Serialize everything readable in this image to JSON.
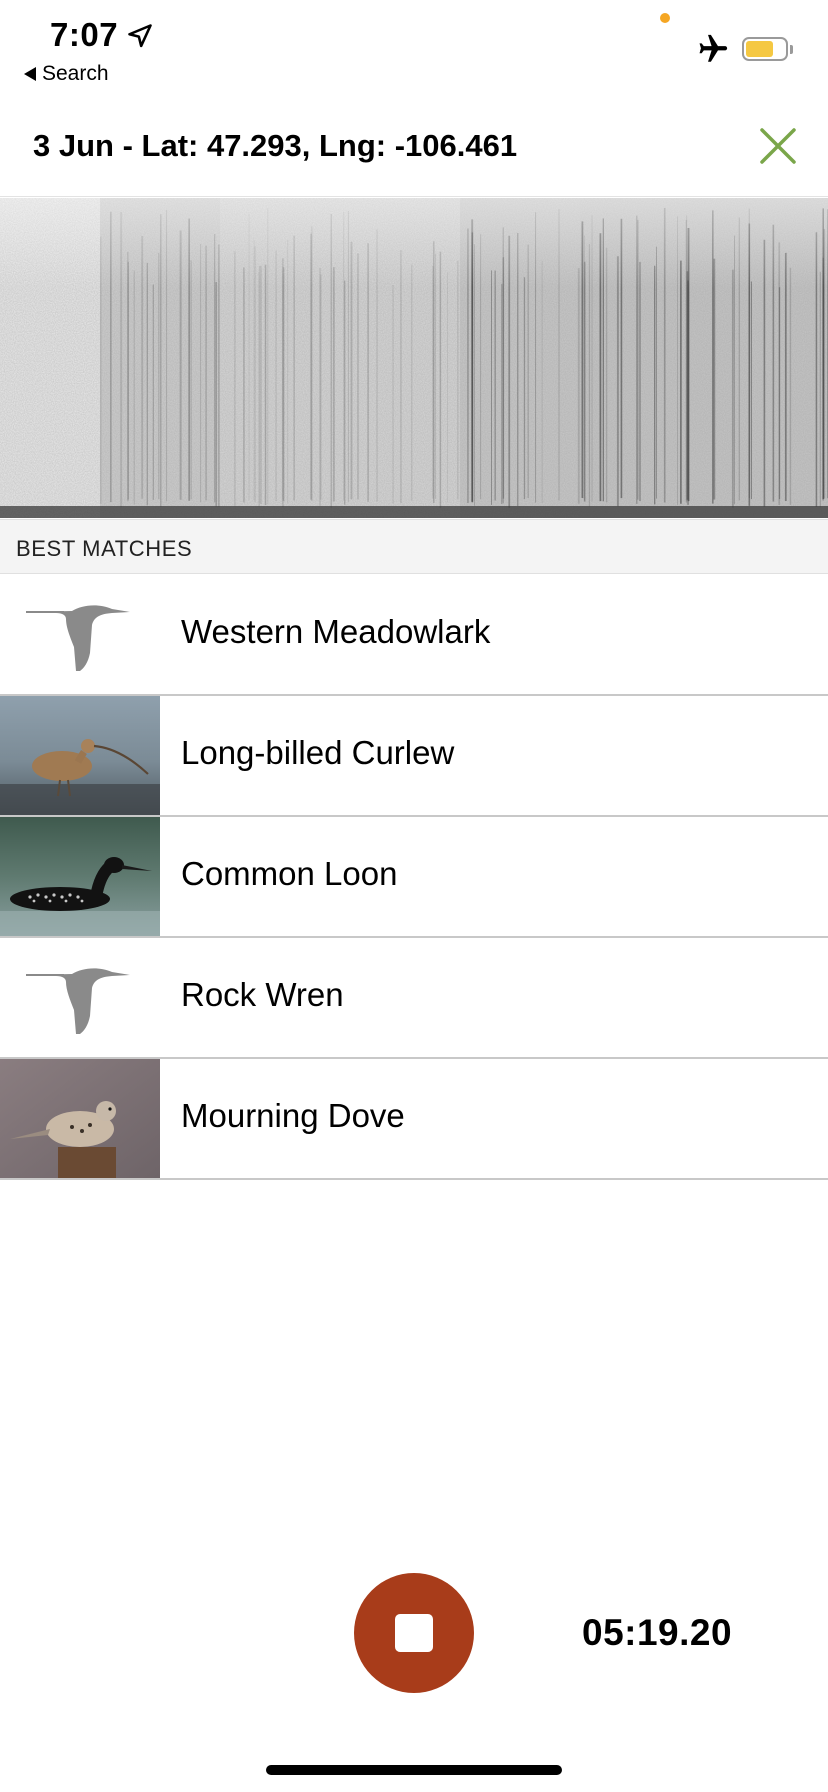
{
  "status_bar": {
    "time": "7:07",
    "back_label": "Search",
    "icons": [
      "location-arrow-icon",
      "airplane-icon",
      "battery-icon"
    ],
    "battery_level": 0.7,
    "colors": {
      "privacy_dot": "#f5a623",
      "battery_fill": "#f5c842"
    }
  },
  "header": {
    "title": "3 Jun - Lat: 47.293, Lng: -106.461",
    "close_icon": "close-x-icon",
    "close_color": "#7aa64a"
  },
  "spectrogram": {
    "icon": "spectrogram-image"
  },
  "matches": {
    "section_label": "BEST MATCHES",
    "items": [
      {
        "name": "Western Meadowlark",
        "thumb": "placeholder-bird-logo"
      },
      {
        "name": "Long-billed Curlew",
        "thumb": "curlew-photo"
      },
      {
        "name": "Common Loon",
        "thumb": "loon-photo"
      },
      {
        "name": "Rock Wren",
        "thumb": "placeholder-bird-logo"
      },
      {
        "name": "Mourning Dove",
        "thumb": "dove-photo"
      }
    ]
  },
  "recorder": {
    "stop_icon": "stop-icon",
    "stop_color": "#a83c1a",
    "timer": "05:19.20"
  }
}
